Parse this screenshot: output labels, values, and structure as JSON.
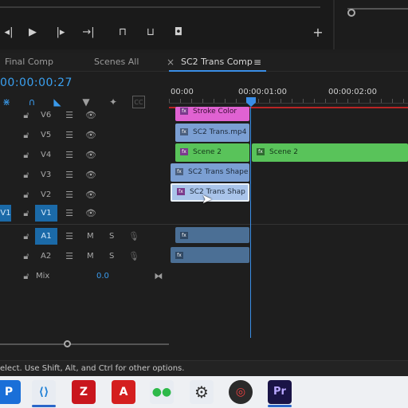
{
  "monitor": {
    "controls": [
      {
        "name": "step-back-icon",
        "glyph": "◂|"
      },
      {
        "name": "play-icon",
        "glyph": "▶"
      },
      {
        "name": "step-forward-icon",
        "glyph": "|▸"
      },
      {
        "name": "go-to-out-icon",
        "glyph": "→|"
      },
      {
        "name": "lift-icon",
        "glyph": "⊓"
      },
      {
        "name": "extract-icon",
        "glyph": "⊔"
      },
      {
        "name": "export-frame-icon",
        "glyph": "◘"
      },
      {
        "name": "add-button-icon",
        "glyph": "+"
      }
    ]
  },
  "tabs": {
    "final_comp": "Final Comp",
    "scenes_all": "Scenes All",
    "close_glyph": "×",
    "sc2_trans_comp": "SC2 Trans Comp",
    "menu_glyph": "≡"
  },
  "timeline": {
    "timecode": "00:00:00:27",
    "ruler": [
      "00:00",
      "00:00:01:00",
      "00:00:02:00"
    ]
  },
  "tracks": {
    "video": [
      {
        "id": "V6",
        "label": "V6"
      },
      {
        "id": "V5",
        "label": "V5"
      },
      {
        "id": "V4",
        "label": "V4"
      },
      {
        "id": "V3",
        "label": "V3"
      },
      {
        "id": "V2",
        "label": "V2"
      },
      {
        "id": "V1",
        "label": "V1",
        "source": "V1"
      }
    ],
    "audio": [
      {
        "id": "A1",
        "label": "A1",
        "m": "M",
        "s": "S"
      },
      {
        "id": "A2",
        "label": "A2",
        "m": "M",
        "s": "S"
      }
    ],
    "mix": {
      "label": "Mix",
      "value": "0.0"
    }
  },
  "clips": {
    "v6": "Stroke Color",
    "v5": "SC2 Trans.mp4",
    "v4a": "Scene 2",
    "v4b": "Scene 2",
    "v3": "SC2 Trans Shape",
    "v2": "SC2 Trans Shap",
    "fx_badge": "fx"
  },
  "status": {
    "text": "elect. Use Shift, Alt, and Ctrl for other options."
  },
  "taskbar": {
    "apps": [
      {
        "name": "taskbar-app-new",
        "glyph": "P"
      },
      {
        "name": "taskbar-app-vscode",
        "glyph": "⟨⟩"
      },
      {
        "name": "taskbar-app-filezilla",
        "glyph": "Z"
      },
      {
        "name": "taskbar-app-acrobat",
        "glyph": "A"
      },
      {
        "name": "taskbar-app-wechat",
        "glyph": "●●"
      },
      {
        "name": "taskbar-app-settings",
        "glyph": "⚙"
      },
      {
        "name": "taskbar-app-davinci",
        "glyph": "◎"
      },
      {
        "name": "taskbar-app-premiere",
        "glyph": "Pr"
      }
    ]
  },
  "colors": {
    "accent_blue": "#3a8ee6",
    "video_clip": "#7b9fd3",
    "scene_clip": "#59c35a",
    "stroke_clip": "#e062d2",
    "inout_red": "#b92424"
  }
}
